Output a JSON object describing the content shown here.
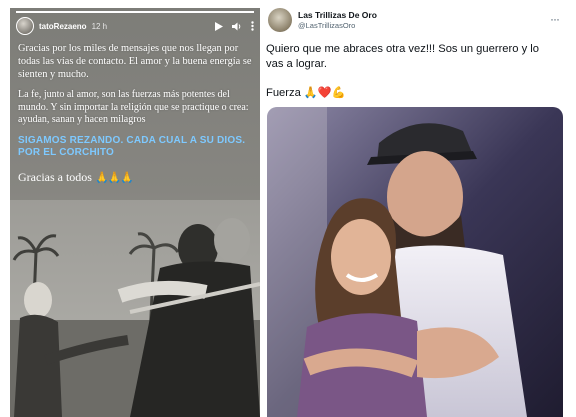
{
  "story": {
    "username": "tatoRezaeno",
    "time": "12 h",
    "paragraphs": [
      "Gracias por los miles de mensajes que nos llegan por todas las vías de contacto. El amor y la buena energía se sienten y mucho.",
      "La fe, junto al amor, son las fuerzas más potentes del mundo. Y sin importar la religión que se practique o crea: ayudan, sanan y hacen milagros"
    ],
    "highlight": "SIGAMOS REZANDO. CADA CUAL A SU DIOS. POR EL CORCHITO",
    "closing": "Gracias a todos",
    "closing_emoji": "🙏🙏🙏",
    "colors": {
      "highlight": "#7ec9ff",
      "text": "#ffffff"
    }
  },
  "tweet": {
    "name": "Las Trillizas De Oro",
    "handle": "@LasTrillizasOro",
    "more": "···",
    "lines": [
      "Quiero que me abraces otra vez!!! Sos un guerrero y lo",
      "vas a lograr."
    ],
    "fuerza_label": "Fuerza",
    "fuerza_emoji": "🙏❤️💪"
  }
}
